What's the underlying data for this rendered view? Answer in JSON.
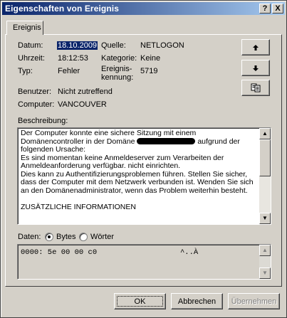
{
  "window": {
    "title": "Eigenschaften von Ereignis",
    "help": "?",
    "close": "X"
  },
  "tab": {
    "label": "Ereignis"
  },
  "fields": {
    "datum_label": "Datum:",
    "datum_value": "18.10.2009",
    "uhrzeit_label": "Uhrzeit:",
    "uhrzeit_value": "18:12:53",
    "typ_label": "Typ:",
    "typ_value": "Fehler",
    "benutzer_label": "Benutzer:",
    "benutzer_value": "Nicht zutreffend",
    "computer_label": "Computer:",
    "computer_value": "VANCOUVER",
    "quelle_label": "Quelle:",
    "quelle_value": "NETLOGON",
    "kategorie_label": "Kategorie:",
    "kategorie_value": "Keine",
    "ereignis_label_1": "Ereignis-",
    "ereignis_label_2": "kennung:",
    "ereignis_value": "5719"
  },
  "side_buttons": {
    "up_icon": "arrow-up-icon",
    "down_icon": "arrow-down-icon",
    "copy_icon": "copy-icon"
  },
  "beschreibung": {
    "label": "Beschreibung:",
    "line1": "Der Computer konnte eine sichere Sitzung mit einem",
    "line2_pre": "Domänencontroller in der Domäne",
    "line2_post": "aufgrund der",
    "line3": "folgenden Ursache:",
    "line4": "Es sind momentan keine Anmeldeserver zum Verarbeiten der",
    "line5": "Anmeldeanforderung verfügbar.  nicht einrichten.",
    "line6": "Dies kann zu Authentifizierungsproblemen führen. Stellen Sie sicher,",
    "line7": "dass der Computer mit dem Netzwerk verbunden ist. Wenden Sie sich",
    "line8": "an den Domänenadministrator, wenn das Problem weiterhin besteht.",
    "line9": "",
    "line10": "ZUSÄTZLICHE INFORMATIONEN"
  },
  "daten": {
    "label": "Daten:",
    "bytes_label": "Bytes",
    "woerter_label": "Wörter",
    "selected": "Bytes",
    "hex_line": "0000: 5e 00 00 c0",
    "ascii_line": "^..À"
  },
  "footer": {
    "ok": "OK",
    "abbrechen": "Abbrechen",
    "uebernehmen": "Übernehmen"
  },
  "colors": {
    "titlebar_start": "#0a246a",
    "titlebar_end": "#a6caf0",
    "face": "#d4d0c8",
    "selection": "#0a246a"
  }
}
